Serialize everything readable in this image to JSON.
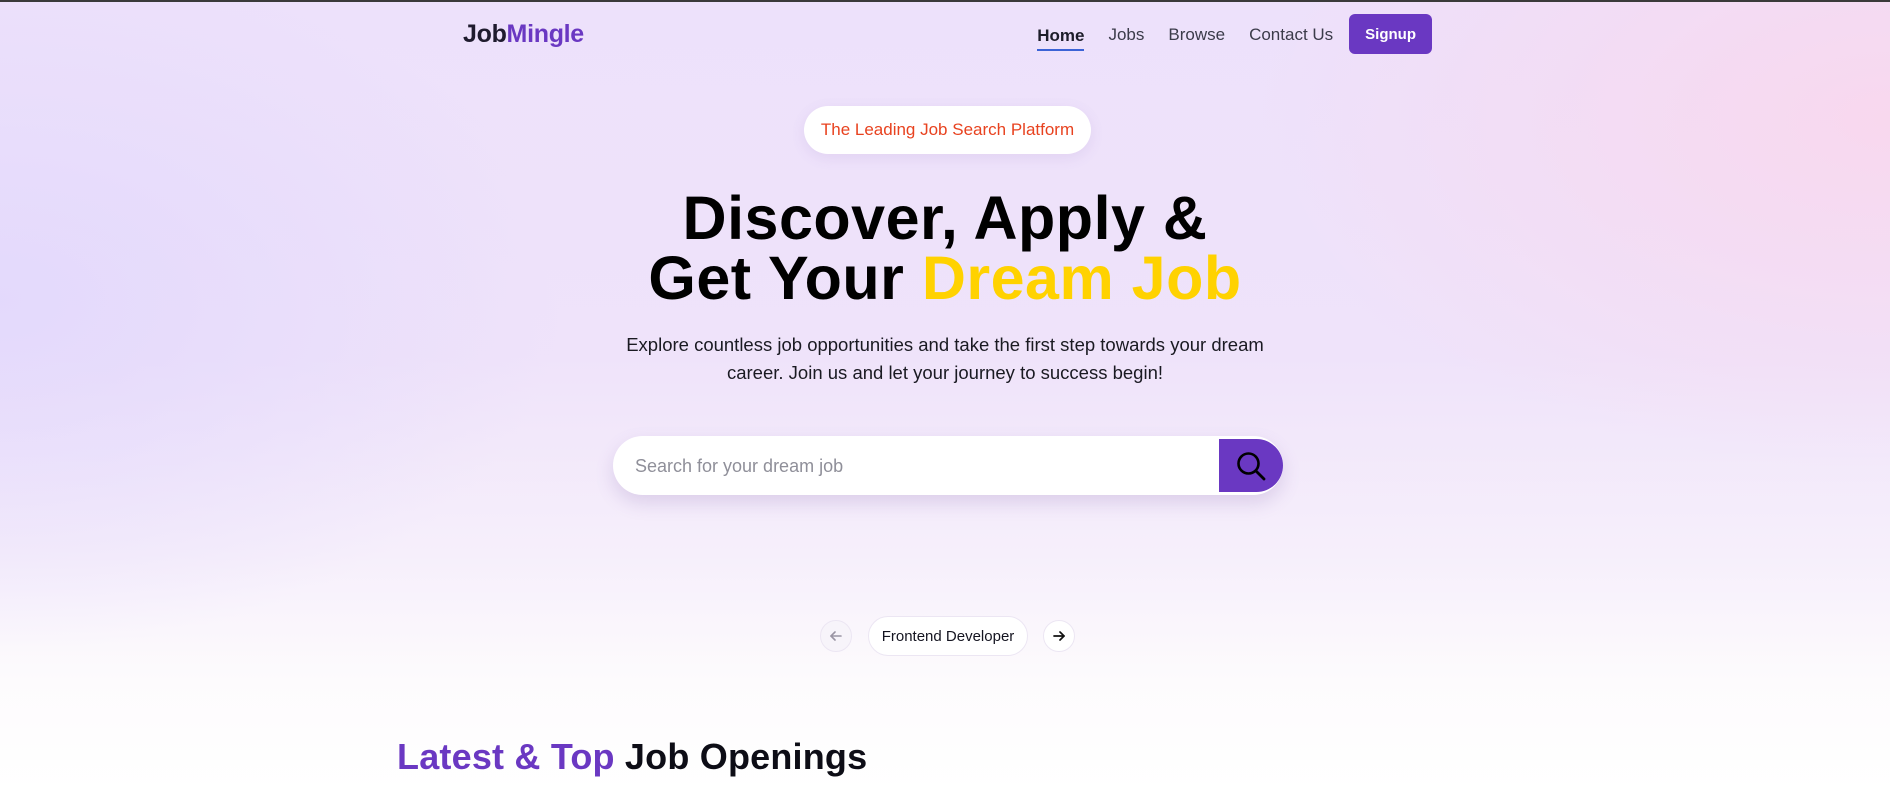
{
  "nav": {
    "logo_part1": "Job",
    "logo_part2": "Mingle",
    "links": [
      "Home",
      "Jobs",
      "Browse",
      "Contact Us"
    ],
    "signup_label": "Signup"
  },
  "hero": {
    "badge": "The Leading Job Search Platform",
    "headline_line1": "Discover, Apply &",
    "headline_line2_prefix": "Get Your ",
    "headline_line2_highlight": "Dream Job",
    "subtitle": "Explore countless job opportunities and take the first step towards your dream career. Join us and let your journey to success begin!"
  },
  "search": {
    "placeholder": "Search for your dream job",
    "button_icon": "search-icon"
  },
  "carousel": {
    "items": [
      "Frontend Developer"
    ],
    "prev_icon": "arrow-left-icon",
    "next_icon": "arrow-right-icon"
  },
  "section": {
    "title_highlight": "Latest & Top",
    "title_rest": " Job Openings"
  },
  "colors": {
    "brand": "#6a38c2",
    "highlight": "#ffd200",
    "badge_text": "#e8421f"
  }
}
